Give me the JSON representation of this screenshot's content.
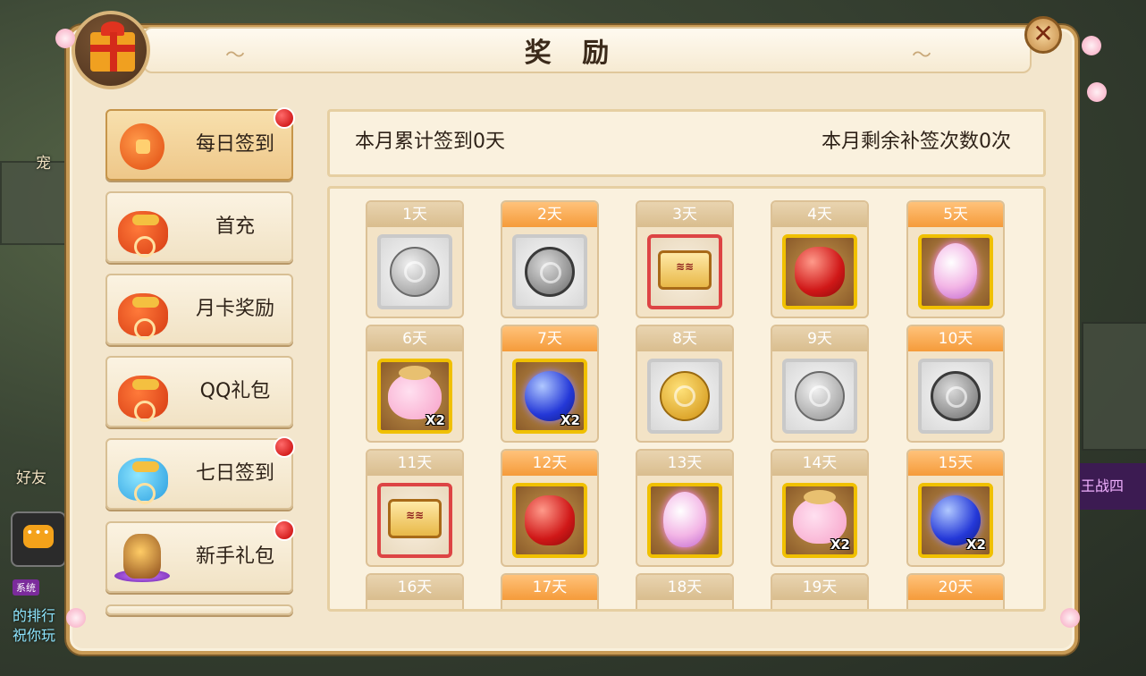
{
  "dialog": {
    "title": "奖 励",
    "close_symbol": "✕"
  },
  "menu": [
    {
      "label": "每日签到",
      "icon": "lantern-icon",
      "active": true,
      "red_dot": true
    },
    {
      "label": "首充",
      "icon": "red-bag-icon",
      "active": false,
      "red_dot": false
    },
    {
      "label": "月卡奖励",
      "icon": "red-bag-icon",
      "active": false,
      "red_dot": false
    },
    {
      "label": "QQ礼包",
      "icon": "red-bag-icon",
      "active": false,
      "red_dot": false
    },
    {
      "label": "七日签到",
      "icon": "blue-bag-icon",
      "active": false,
      "red_dot": true
    },
    {
      "label": "新手礼包",
      "icon": "crystal-icon",
      "active": false,
      "red_dot": true
    }
  ],
  "info": {
    "left": "本月累计签到0天",
    "right": "本月剩余补签次数0次"
  },
  "days": [
    {
      "label": "1天",
      "item": "silver-coin",
      "frame": "silver",
      "qty": ""
    },
    {
      "label": "2天",
      "item": "dark-coin",
      "frame": "silver",
      "qty": ""
    },
    {
      "label": "3天",
      "item": "scroll",
      "frame": "red",
      "qty": ""
    },
    {
      "label": "4天",
      "item": "red-gem",
      "frame": "gold",
      "qty": ""
    },
    {
      "label": "5天",
      "item": "egg",
      "frame": "gold",
      "qty": ""
    },
    {
      "label": "6天",
      "item": "pet",
      "frame": "gold",
      "qty": "X2"
    },
    {
      "label": "7天",
      "item": "blue-gem",
      "frame": "gold",
      "qty": "X2"
    },
    {
      "label": "8天",
      "item": "gold-coin",
      "frame": "silver",
      "qty": ""
    },
    {
      "label": "9天",
      "item": "silver-coin",
      "frame": "silver",
      "qty": ""
    },
    {
      "label": "10天",
      "item": "dark-coin",
      "frame": "silver",
      "qty": ""
    },
    {
      "label": "11天",
      "item": "scroll",
      "frame": "red",
      "qty": ""
    },
    {
      "label": "12天",
      "item": "red-gem",
      "frame": "gold",
      "qty": ""
    },
    {
      "label": "13天",
      "item": "egg",
      "frame": "gold",
      "qty": ""
    },
    {
      "label": "14天",
      "item": "pet",
      "frame": "gold",
      "qty": "X2"
    },
    {
      "label": "15天",
      "item": "blue-gem",
      "frame": "gold",
      "qty": "X2"
    },
    {
      "label": "16天",
      "item": "",
      "frame": "",
      "qty": ""
    },
    {
      "label": "17天",
      "item": "",
      "frame": "",
      "qty": ""
    },
    {
      "label": "18天",
      "item": "",
      "frame": "",
      "qty": ""
    },
    {
      "label": "19天",
      "item": "",
      "frame": "",
      "qty": ""
    },
    {
      "label": "20天",
      "item": "",
      "frame": "",
      "qty": ""
    }
  ],
  "highlight_days": [
    "2天",
    "5天",
    "7天",
    "10天",
    "12天",
    "15天",
    "17天",
    "20天"
  ],
  "background": {
    "left_text_1": "宠",
    "left_text_2": "好友",
    "system_badge": "系统",
    "system_line_1": "的排行",
    "system_line_2": "祝你玩",
    "right_banner": "王战四"
  },
  "colors": {
    "panel": "#f3e6cd",
    "accent_orange": "#f59b3a",
    "red_dot": "#c40000"
  }
}
